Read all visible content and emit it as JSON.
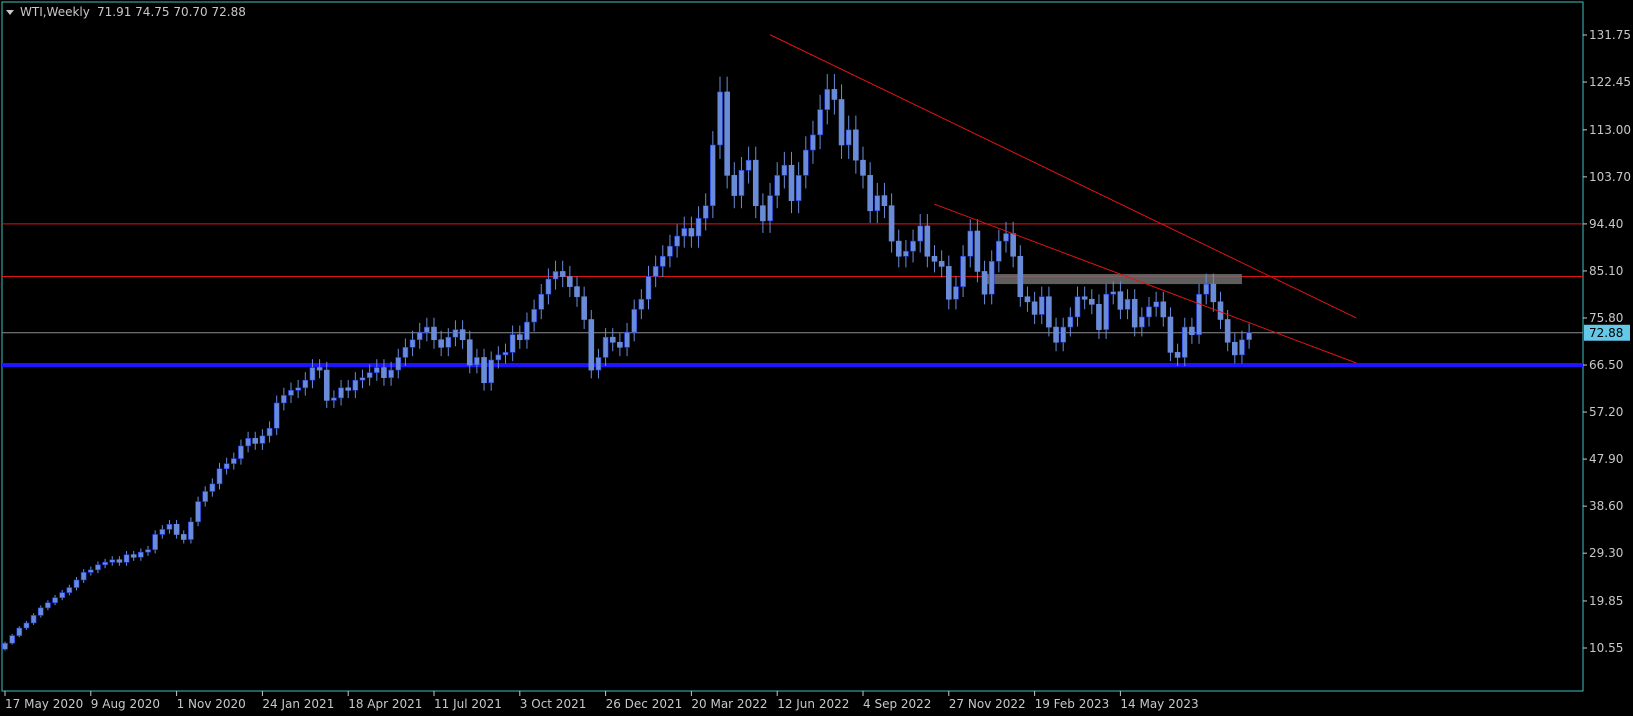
{
  "header": {
    "symbol": "WTI,Weekly",
    "ohlc": "71.91 74.75 70.70 72.88"
  },
  "colors": {
    "background": "#000000",
    "frame": "#3fbfbf",
    "candle_body": "#6a8cd8",
    "candle_bull": "#1e3cf0",
    "trendline": "#e01414",
    "support": "#1e14ff",
    "price_line": "#8c8c8c",
    "zone": "#6e6e6e",
    "axis_text": "#c8c8c8",
    "price_tag_bg": "#64c8e8"
  },
  "chart_data": {
    "type": "candlestick",
    "timeframe": "Weekly",
    "last_price_label": "72.88",
    "ylim": [
      6.0,
      136.0
    ],
    "y_ticks": [
      "131.75",
      "122.45",
      "113.00",
      "103.70",
      "94.40",
      "85.10",
      "75.80",
      "66.50",
      "57.20",
      "47.90",
      "38.60",
      "29.30",
      "19.85",
      "10.55"
    ],
    "x_ticks": [
      "17 May 2020",
      "9 Aug 2020",
      "1 Nov 2020",
      "24 Jan 2021",
      "18 Apr 2021",
      "11 Jul 2021",
      "3 Oct 2021",
      "26 Dec 2021",
      "20 Mar 2022",
      "12 Jun 2022",
      "4 Sep 2022",
      "27 Nov 2022",
      "19 Feb 2023",
      "14 May 2023"
    ],
    "horizontal_levels": [
      {
        "price": 94.4,
        "style": "resistance"
      },
      {
        "price": 84.0,
        "style": "resistance"
      },
      {
        "price": 72.88,
        "style": "last-price"
      },
      {
        "price": 66.5,
        "style": "support"
      }
    ],
    "trendlines": [
      {
        "from": {
          "week": 107,
          "price": 131.8
        },
        "to": {
          "week": 189,
          "price": 75.8
        }
      },
      {
        "from": {
          "week": 130,
          "price": 98.3
        },
        "to": {
          "week": 189,
          "price": 66.9
        }
      }
    ],
    "zones": [
      {
        "from_week": 137,
        "to_week": 173,
        "low": 82.5,
        "high": 84.5
      }
    ],
    "closes": [
      11.5,
      13.0,
      14.5,
      15.5,
      17.0,
      18.5,
      19.5,
      20.5,
      21.5,
      22.5,
      24.0,
      25.5,
      26.0,
      27.0,
      27.5,
      28.0,
      27.5,
      29.0,
      28.5,
      29.5,
      30.0,
      33.0,
      34.0,
      35.0,
      33.0,
      32.0,
      35.5,
      39.5,
      41.5,
      43.0,
      46.0,
      47.0,
      48.0,
      50.5,
      52.0,
      51.0,
      52.5,
      54.0,
      59.0,
      60.5,
      61.5,
      62.0,
      63.5,
      66.0,
      65.5,
      59.5,
      60.0,
      62.0,
      61.5,
      63.5,
      64.0,
      65.0,
      66.0,
      64.0,
      65.5,
      68.0,
      70.0,
      71.5,
      73.0,
      74.0,
      71.5,
      70.0,
      72.0,
      73.5,
      71.5,
      66.5,
      68.0,
      63.0,
      67.5,
      68.5,
      69.0,
      72.5,
      71.5,
      75.0,
      77.5,
      80.5,
      83.5,
      85.0,
      84.0,
      82.0,
      80.0,
      75.5,
      65.5,
      68.0,
      72.0,
      71.0,
      70.0,
      73.0,
      77.5,
      79.5,
      84.0,
      86.0,
      88.0,
      90.0,
      92.0,
      93.5,
      92.0,
      95.5,
      98.0,
      110.0,
      120.5,
      104.0,
      100.0,
      105.0,
      107.0,
      98.0,
      95.0,
      100.0,
      104.0,
      106.0,
      99.0,
      104.0,
      109.0,
      112.0,
      117.0,
      121.0,
      119.0,
      110.0,
      113.0,
      107.0,
      104.0,
      97.0,
      100.0,
      98.0,
      91.0,
      88.0,
      89.0,
      91.0,
      94.0,
      88.0,
      87.0,
      86.0,
      79.5,
      82.0,
      88.0,
      93.0,
      85.0,
      80.5,
      87.0,
      91.0,
      92.5,
      88.0,
      80.0,
      79.0,
      76.5,
      80.0,
      74.0,
      71.0,
      74.0,
      76.0,
      80.0,
      79.5,
      78.5,
      73.5,
      80.5,
      81.0,
      77.5,
      79.5,
      74.0,
      76.0,
      78.0,
      79.0,
      76.0,
      69.0,
      68.0,
      74.0,
      72.5,
      80.5,
      82.5,
      79.0,
      75.5,
      71.0,
      68.5,
      71.5,
      72.88
    ],
    "series": [
      {
        "name": "WTI,Weekly",
        "values_key": "closes"
      }
    ]
  }
}
